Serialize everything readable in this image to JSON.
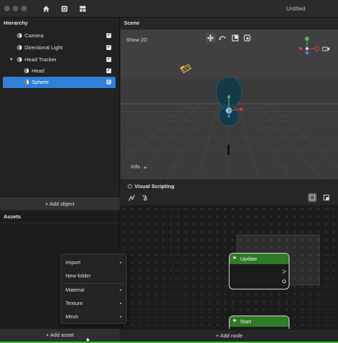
{
  "window": {
    "title": "Untitled"
  },
  "hierarchy": {
    "title": "Hierarchy",
    "items": [
      {
        "label": "Camera",
        "checked": true,
        "selected": false,
        "depth": 0
      },
      {
        "label": "Directional Light",
        "checked": true,
        "selected": false,
        "depth": 0
      },
      {
        "label": "Head Tracker",
        "checked": true,
        "selected": false,
        "depth": 0,
        "expanded": true
      },
      {
        "label": "Head",
        "checked": true,
        "selected": false,
        "depth": 1
      },
      {
        "label": "Sphere",
        "checked": true,
        "selected": true,
        "depth": 1
      }
    ],
    "add_label": "+ Add object"
  },
  "assets": {
    "title": "Assets",
    "add_label": "+ Add asset"
  },
  "context_menu": {
    "items": [
      {
        "label": "Import",
        "submenu": true
      },
      {
        "label": "New folder",
        "submenu": false
      },
      {
        "label": "Material",
        "submenu": true
      },
      {
        "label": "Texture",
        "submenu": true
      },
      {
        "label": "Mesh",
        "submenu": true
      }
    ],
    "arrow_glyph": "▸"
  },
  "scene": {
    "title": "Scene",
    "show2d_label": "Show 2D",
    "info_label": "Info",
    "info_caret": "▲",
    "gizmo": {
      "y": "Y",
      "x": "X",
      "z": "Z"
    }
  },
  "visual_scripting": {
    "title": "Visual Scripting",
    "nodes": [
      {
        "label": "Update"
      },
      {
        "label": "Start"
      }
    ],
    "add_label": "+ Add node"
  },
  "icons": {
    "home": "home-icon",
    "grid": "grid-icon",
    "layout": "layout-icon",
    "move": "move-tool-icon",
    "rotate": "rotate-tool-icon",
    "scale": "scale-tool-icon",
    "rect": "rect-tool-icon",
    "camera": "camera-icon",
    "flag": "flag-icon",
    "play": "play-arrow-icon"
  },
  "colors": {
    "selection": "#2f80d9",
    "node_header": "#2f7a26",
    "status_line": "#3fbf2f",
    "axis_x": "#e04040",
    "axis_y": "#40c060",
    "axis_z": "#4080e0"
  }
}
